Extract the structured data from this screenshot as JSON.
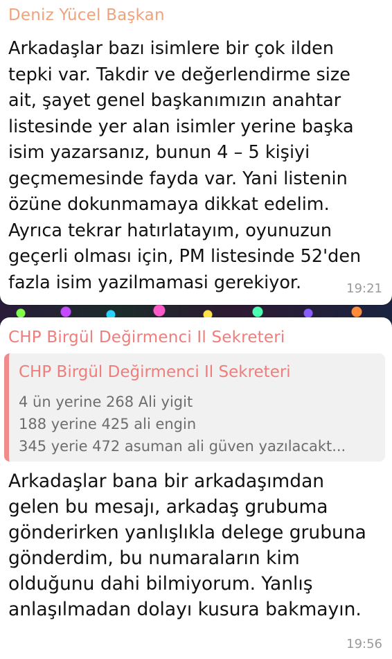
{
  "messages": [
    {
      "sender": "Deniz Yücel Başkan",
      "text": "Arkadaşlar bazı isimlere bir çok ilden tepki var. Takdir ve değerlendirme size ait, şayet genel başkanımızın anahtar listesinde yer alan isimler yerine başka isim yazarsanız, bunun 4 – 5 kişiyi geçmemesinde fayda var. Yani listenin özüne dokunmamaya dikkat edelim. Ayrıca tekrar hatırlatayım, oyunuzun geçerli olması için, PM listesinde 52'den fazla isim yazilmamasi gerekiyor.",
      "time": "19:21",
      "sender_color": "#f0a27a"
    },
    {
      "sender": "CHP Birgül Değirmenci Il Sekreteri",
      "quote": {
        "sender": "CHP Birgül Değirmenci Il Sekreteri",
        "lines": [
          "4 ün yerine 268 Ali yigit",
          "188 yerine  425 ali engin",
          "345 yerie 472 asuman ali güven yazılacakt..."
        ]
      },
      "text": "Arkadaşlar bana bir arkadaşımdan gelen bu mesajı, arkadaş grubuma gönderirken yanlışlıkla delege grubuna gönderdim, bu numaraların kim olduğunu dahi bilmiyorum. Yanlış anlaşılmadan dolayı kusura bakmayın.",
      "time": "19:56",
      "sender_color": "#ee7e7c"
    }
  ]
}
